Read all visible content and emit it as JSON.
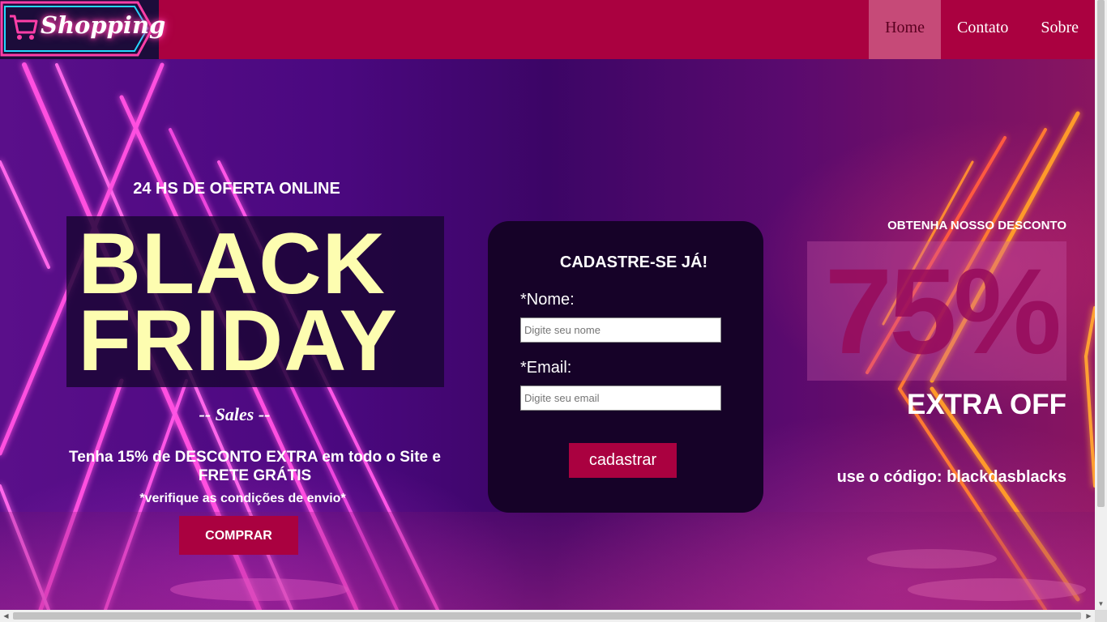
{
  "brand": {
    "logo_text": "Shopping",
    "logo_icon": "shopping-cart-icon"
  },
  "nav": {
    "items": [
      {
        "label": "Home",
        "active": true
      },
      {
        "label": "Contato",
        "active": false
      },
      {
        "label": "Sobre",
        "active": false
      }
    ]
  },
  "promo": {
    "tagline": "24 HS DE OFERTA ONLINE",
    "headline_1": "BLACK",
    "headline_2": "FRIDAY",
    "subhead": "-- Sales --",
    "discount_text": "Tenha 15% de DESCONTO EXTRA em todo o Site e FRETE GRÁTIS",
    "note": "*verifique as condições de envio*",
    "buy_label": "COMPRAR"
  },
  "form": {
    "title": "CADASTRE-SE JÁ!",
    "name_label": "*Nome:",
    "name_placeholder": "Digite seu nome",
    "name_value": "",
    "email_label": "*Email:",
    "email_placeholder": "Digite seu email",
    "email_value": "",
    "submit_label": "cadastrar"
  },
  "offer": {
    "intro": "OBTENHA NOSSO DESCONTO",
    "percent": "75%",
    "extra": "EXTRA OFF",
    "code_text": "use o código: blackdasblacks"
  },
  "colors": {
    "accent": "#aa0140",
    "headline": "#fdfdb0",
    "card": "#160228",
    "logo_bg": "#1c0c3a"
  }
}
